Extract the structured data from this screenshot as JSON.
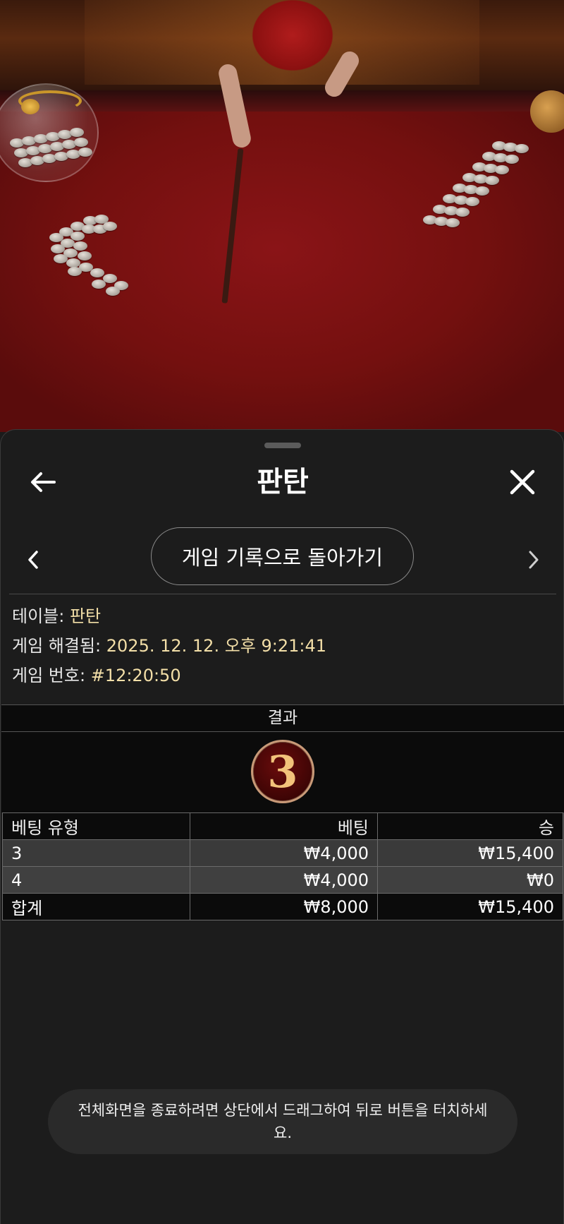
{
  "sheet": {
    "title": "판탄",
    "history_button": "게임 기록으로 돌아가기"
  },
  "info": {
    "table_label": "테이블:",
    "table_value": "판탄",
    "resolved_label": "게임 해결됨:",
    "resolved_value": "2025. 12. 12. 오후 9:21:41",
    "number_label": "게임 번호:",
    "number_value": "#12:20:50"
  },
  "result": {
    "header": "결과",
    "value": "3"
  },
  "bets": {
    "headers": [
      "베팅 유형",
      "베팅",
      "승"
    ],
    "rows": [
      [
        "3",
        "₩4,000",
        "₩15,400"
      ],
      [
        "4",
        "₩4,000",
        "₩0"
      ]
    ],
    "total": [
      "합계",
      "₩8,000",
      "₩15,400"
    ]
  },
  "toast": {
    "text": "전체화면을 종료하려면 상단에서 드래그하여 뒤로 버튼을 터치하세요."
  },
  "icons": {
    "back": "arrow-left-icon",
    "close": "close-icon",
    "prev": "chevron-left-icon",
    "next": "chevron-right-icon"
  },
  "colors": {
    "sheet_bg": "#1c1c1c",
    "value_text": "#f3dfa8",
    "result_ball": "#4a0808",
    "table_felt": "#7a1012"
  }
}
